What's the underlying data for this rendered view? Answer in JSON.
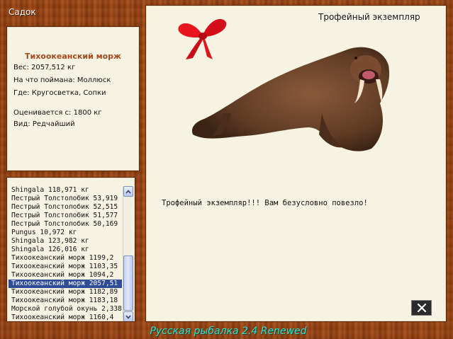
{
  "window": {
    "title": "Садок"
  },
  "fish_info": {
    "name": "Тихоокеанский морж",
    "weight": "Вес: 2057,512 кг",
    "bait": "На что поймана: Моллюск",
    "location": "Где: Кругосветка, Сопки",
    "valued_from": "Оценивается с: 1800 кг",
    "kind": "Вид: Редчайший"
  },
  "catch_list": {
    "items": [
      "Shingala 118,971 кг",
      "Пестрый Толстолобик 53,919",
      "Пестрый Толстолобик 52,515",
      "Пестрый Толстолобик 51,577",
      "Пестрый Толстолобик 50,169",
      "Pungus 10,972 кг",
      "Shingala 123,982 кг",
      "Shingala 126,016 кг",
      "Тихоокеанский морж 1199,2",
      "Тихоокеанский морж 1103,35",
      "Тихоокеанский морж 1094,2",
      "Тихоокеанский морж 2057,51",
      "Тихоокеанский морж 1182,89",
      "Тихоокеанский морж 1183,18",
      "Морской голубой окунь 2,338",
      "Тихоокеанский морж 1160,4"
    ],
    "selected_index": 11
  },
  "trophy": {
    "label": "Трофейный экземпляр",
    "message": "Трофейный экземпляр!!! Вам безусловно повезло!"
  },
  "footer": {
    "text": "Русская рыбалка 2.4 Renewed"
  },
  "icons": {
    "scroll_up": "chevron-up-icon",
    "scroll_down": "chevron-down-icon",
    "close": "close-icon",
    "bow": "red-bow-icon",
    "walrus": "walrus-image"
  },
  "colors": {
    "fish_name": "#a8481b",
    "footer_text": "#38e0c4",
    "selection": "#2e4d96",
    "panel_bg": "#f6f3e3"
  }
}
